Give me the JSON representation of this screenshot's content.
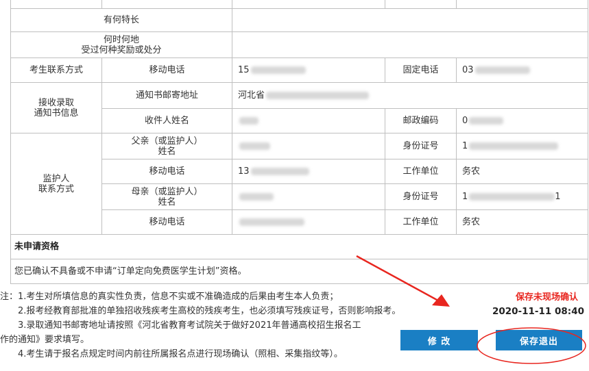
{
  "form": {
    "specialty_label": "有何特长",
    "award_label_line1": "何时何地",
    "award_label_line2": "受过何种奖励或处分",
    "contact_label": "考生联系方式",
    "mobile_label": "移动电话",
    "mobile_value": "15",
    "phone_label": "固定电话",
    "phone_value": "03",
    "notice_label_line1": "接收录取",
    "notice_label_line2": "通知书信息",
    "address_label": "通知书邮寄地址",
    "address_value": "河北省",
    "receiver_label": "收件人姓名",
    "postcode_label": "邮政编码",
    "postcode_value": "0",
    "guardian_label_line1": "监护人",
    "guardian_label_line2": "联系方式",
    "father_label_line1": "父亲（或监护人）",
    "father_label_line2": "姓名",
    "id_label": "身份证号",
    "id_value_father": "1",
    "father_mobile_value": "13",
    "work_label": "工作单位",
    "work_value": "务农",
    "mother_label_line1": "母亲（或监护人）",
    "mother_label_line2": "姓名",
    "id_value_mother": "1",
    "id_value_mother_tail": "1",
    "mother_work_value": "务农"
  },
  "qualification": {
    "title": "未申请资格",
    "text": "您已确认不具备或不申请“订单定向免费医学生计划”资格。"
  },
  "notes": {
    "n1": "注：1.考生对所填信息的真实性负责，信息不实或不准确造成的后果由考生本人负责；",
    "n2": "2.报考经教育部批准的单独招收残疾考生高校的残疾考生，也必须填写残疾证号，否则影响报考。",
    "n3a": "3.录取通知书邮寄地址请按照《河北省教育考试院关于做好2021年普通高校招生报名工",
    "n3b": "作的通知》要求填写。",
    "n4": "4.考生请于报名点规定时间内前往所属报名点进行现场确认（照相、采集指纹等）。"
  },
  "status": {
    "text": "保存未现场确认",
    "date": "2020-11-11 08:40",
    "color": "#e8261f"
  },
  "buttons": {
    "modify": "修  改",
    "save_exit": "保存退出"
  },
  "colors": {
    "button": "#1a7fc4",
    "annotation": "#e8261f"
  }
}
